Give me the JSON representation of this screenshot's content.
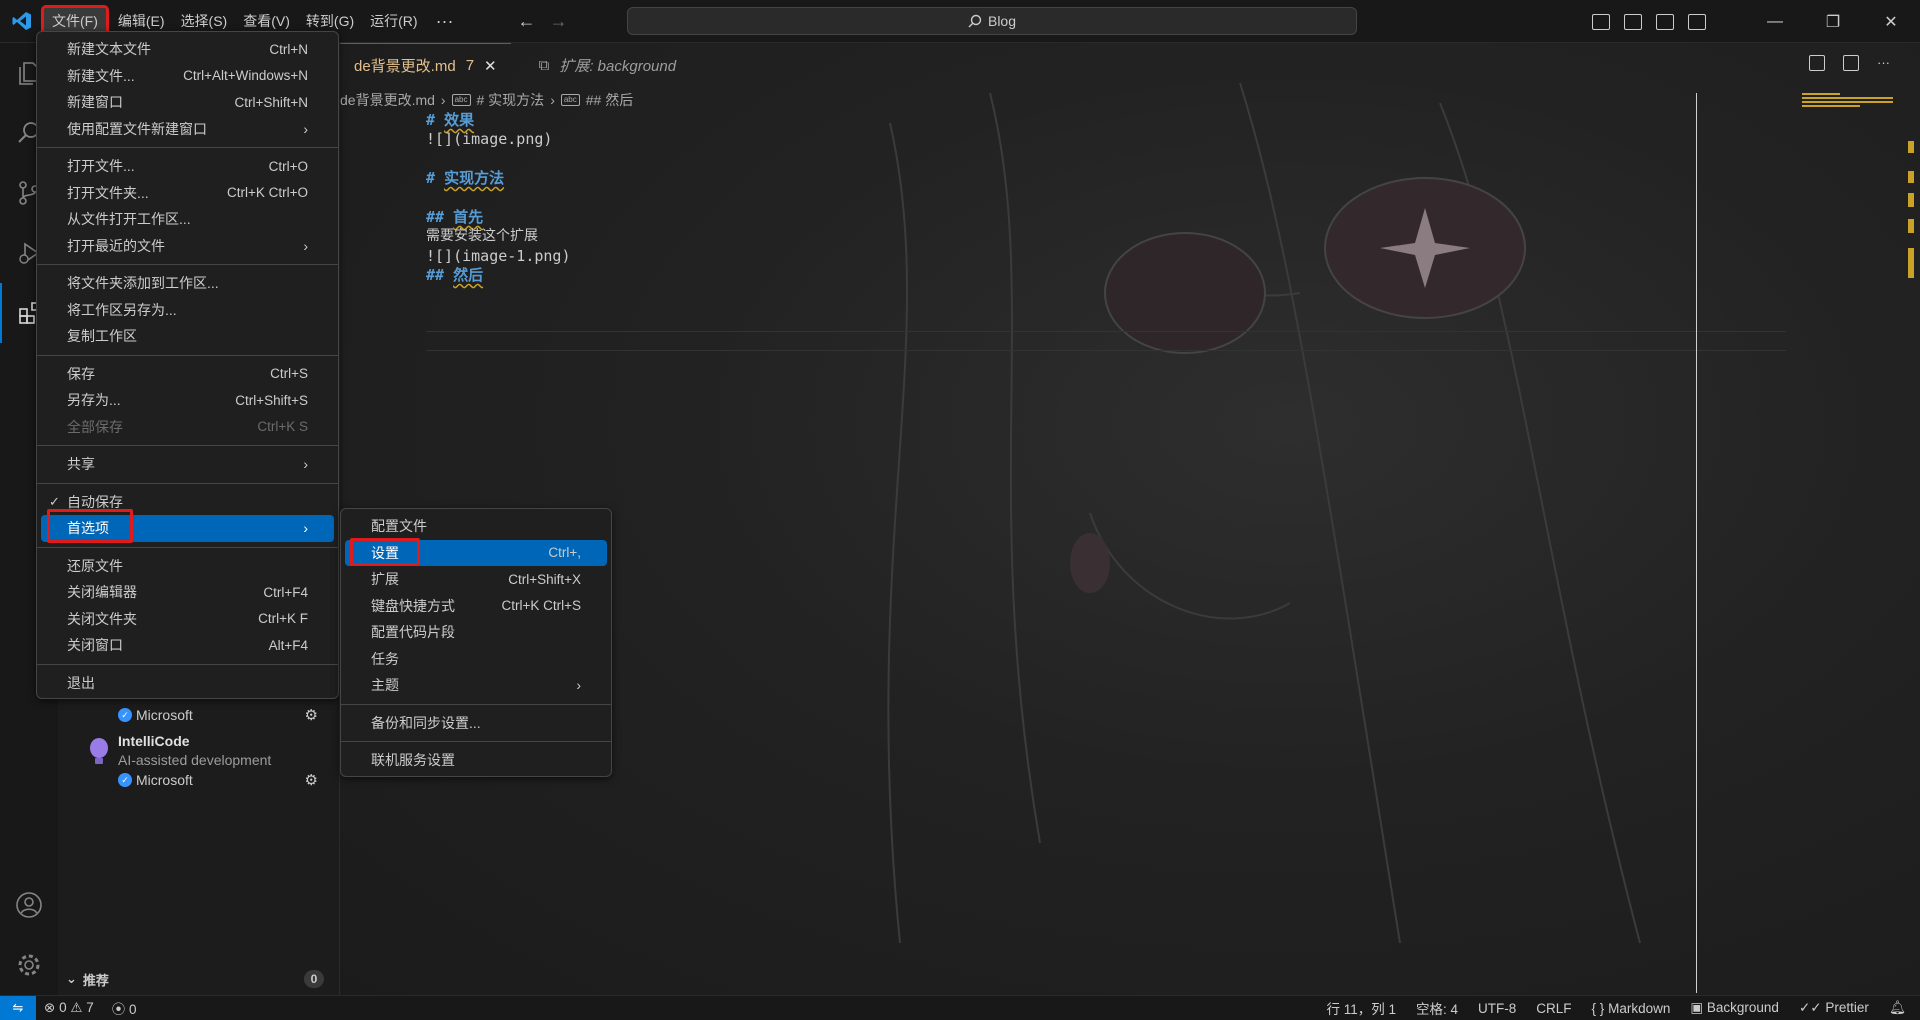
{
  "menubar": {
    "items": [
      "文件(F)",
      "编辑(E)",
      "选择(S)",
      "查看(V)",
      "转到(G)",
      "运行(R)"
    ],
    "more": "···"
  },
  "search": {
    "text": "Blog"
  },
  "tabs": [
    {
      "label": "de背景更改.md",
      "badge": "7",
      "close": "✕"
    },
    {
      "label": "扩展: background"
    }
  ],
  "breadcrumb": [
    "de背景更改.md",
    "# 实现方法",
    "## 然后"
  ],
  "editor": {
    "lines": [
      {
        "kind": "heading",
        "marker": "# ",
        "text": "效果"
      },
      {
        "kind": "link",
        "text": "![](image.png)"
      },
      {
        "kind": "blank",
        "text": ""
      },
      {
        "kind": "heading",
        "marker": "# ",
        "text": "实现方法"
      },
      {
        "kind": "blank",
        "text": ""
      },
      {
        "kind": "heading",
        "marker": "## ",
        "text": "首先"
      },
      {
        "kind": "text",
        "text": "需要安装这个扩展"
      },
      {
        "kind": "link",
        "text": "![](image-1.png)"
      },
      {
        "kind": "heading",
        "marker": "## ",
        "text": "然后"
      }
    ]
  },
  "file_menu": {
    "groups": [
      [
        {
          "label": "新建文本文件",
          "kb": "Ctrl+N"
        },
        {
          "label": "新建文件...",
          "kb": "Ctrl+Alt+Windows+N"
        },
        {
          "label": "新建窗口",
          "kb": "Ctrl+Shift+N"
        },
        {
          "label": "使用配置文件新建窗口",
          "submenu": true
        }
      ],
      [
        {
          "label": "打开文件...",
          "kb": "Ctrl+O"
        },
        {
          "label": "打开文件夹...",
          "kb": "Ctrl+K Ctrl+O"
        },
        {
          "label": "从文件打开工作区..."
        },
        {
          "label": "打开最近的文件",
          "submenu": true
        }
      ],
      [
        {
          "label": "将文件夹添加到工作区..."
        },
        {
          "label": "将工作区另存为..."
        },
        {
          "label": "复制工作区"
        }
      ],
      [
        {
          "label": "保存",
          "kb": "Ctrl+S"
        },
        {
          "label": "另存为...",
          "kb": "Ctrl+Shift+S"
        },
        {
          "label": "全部保存",
          "kb": "Ctrl+K S",
          "disabled": true
        }
      ],
      [
        {
          "label": "共享",
          "submenu": true
        }
      ],
      [
        {
          "label": "自动保存",
          "checked": true
        },
        {
          "label": "首选项",
          "submenu": true,
          "highlighted": true
        }
      ],
      [
        {
          "label": "还原文件"
        },
        {
          "label": "关闭编辑器",
          "kb": "Ctrl+F4"
        },
        {
          "label": "关闭文件夹",
          "kb": "Ctrl+K F"
        },
        {
          "label": "关闭窗口",
          "kb": "Alt+F4"
        }
      ],
      [
        {
          "label": "退出"
        }
      ]
    ]
  },
  "preferences_menu": {
    "groups": [
      [
        {
          "label": "配置文件"
        },
        {
          "label": "设置",
          "kb": "Ctrl+,",
          "highlighted": true
        },
        {
          "label": "扩展",
          "kb": "Ctrl+Shift+X"
        },
        {
          "label": "键盘快捷方式",
          "kb": "Ctrl+K Ctrl+S"
        },
        {
          "label": "配置代码片段"
        },
        {
          "label": "任务"
        },
        {
          "label": "主题",
          "submenu": true
        }
      ],
      [
        {
          "label": "备份和同步设置..."
        }
      ],
      [
        {
          "label": "联机服务设置"
        }
      ]
    ]
  },
  "sidebar": {
    "ext_top_publisher": "Microsoft",
    "ext2": {
      "name": "IntelliCode",
      "desc": "AI-assisted development",
      "publisher": "Microsoft"
    },
    "section": {
      "label": "推荐",
      "count": "0"
    }
  },
  "statusbar": {
    "errors": "0",
    "warnings": "7",
    "ports": "0",
    "position": "行 11，列 1",
    "spaces": "空格: 4",
    "encoding": "UTF-8",
    "eol": "CRLF",
    "language": "Markdown",
    "background": "Background",
    "prettier": "Prettier"
  },
  "colors": {
    "accent": "#0078d4",
    "highlight_box": "#e01b1b",
    "menu_highlight": "#0066b8",
    "warning": "#c9a227"
  }
}
